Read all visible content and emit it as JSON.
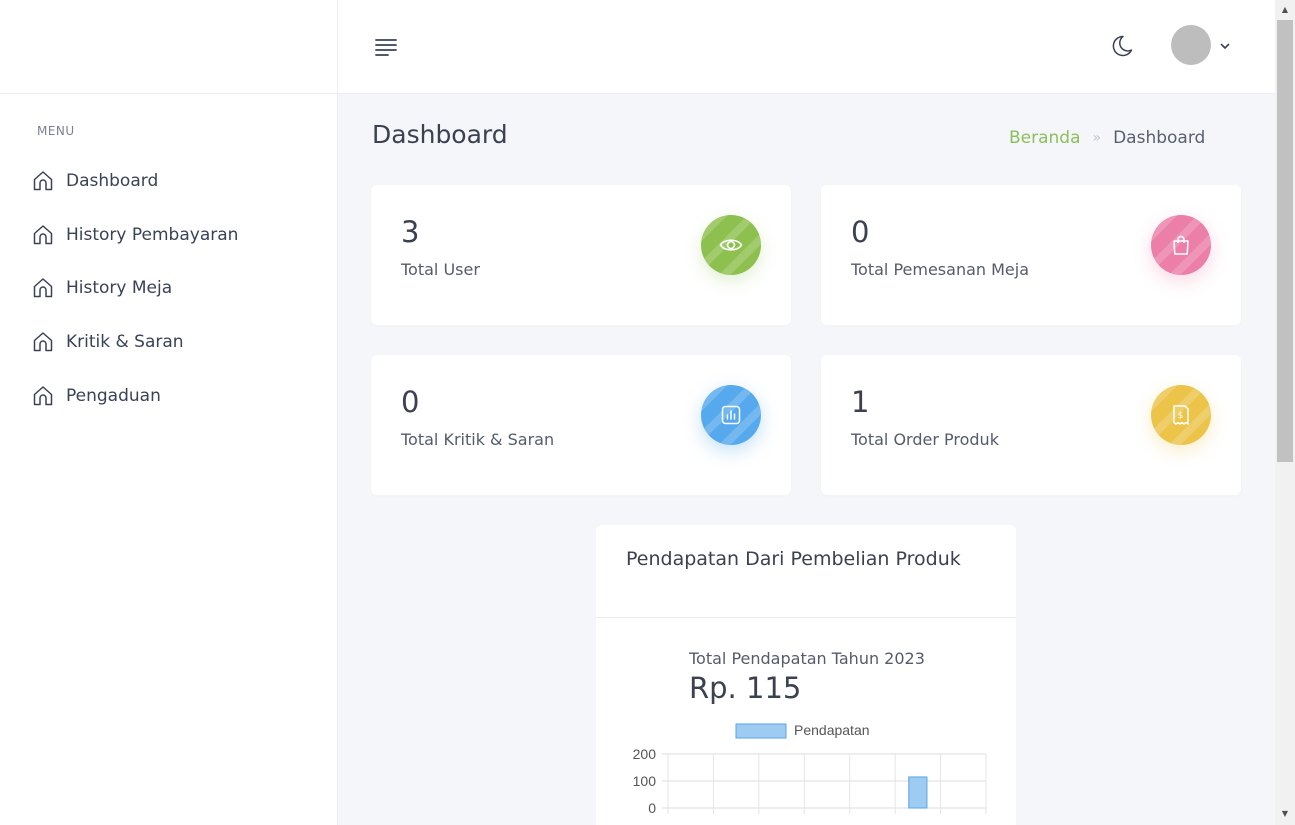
{
  "sidebar": {
    "menu_heading": "MENU",
    "items": [
      {
        "label": "Dashboard",
        "icon": "home-icon"
      },
      {
        "label": "History Pembayaran",
        "icon": "home-icon"
      },
      {
        "label": "History Meja",
        "icon": "home-icon"
      },
      {
        "label": "Kritik & Saran",
        "icon": "home-icon"
      },
      {
        "label": "Pengaduan",
        "icon": "home-icon"
      }
    ]
  },
  "topbar": {
    "menu_icon": "hamburger-menu-icon",
    "theme_icon": "moon-icon",
    "avatar_icon": "avatar",
    "dropdown_icon": "chevron-down-icon"
  },
  "page": {
    "title": "Dashboard",
    "breadcrumb": {
      "home": "Beranda",
      "separator": "»",
      "current": "Dashboard"
    }
  },
  "stats": [
    {
      "value": "3",
      "label": "Total User",
      "icon": "eye-icon",
      "color": "#8dc04e"
    },
    {
      "value": "0",
      "label": "Total Pemesanan Meja",
      "icon": "shopping-bag-icon",
      "color": "#ec7fa8"
    },
    {
      "value": "0",
      "label": "Total Kritik & Saran",
      "icon": "bar-chart-icon",
      "color": "#55a9ec"
    },
    {
      "value": "1",
      "label": "Total Order Produk",
      "icon": "receipt-dollar-icon",
      "color": "#ecc44a"
    }
  ],
  "revenue": {
    "card_title": "Pendapatan Dari Pembelian Produk",
    "subtitle": "Total Pendapatan Tahun 2023",
    "total": "Rp. 115"
  },
  "chart_data": {
    "type": "bar",
    "series": [
      {
        "name": "Pendapatan",
        "values": [
          0,
          0,
          0,
          0,
          0,
          115,
          0
        ],
        "color": "#9ecbf1",
        "border": "#5aa5e3"
      }
    ],
    "yticks": [
      "200",
      "100",
      "0"
    ],
    "ylim": [
      0,
      200
    ],
    "grid": true,
    "legend": "top"
  },
  "colors": {
    "accent_green": "#8cbf59",
    "text_dark": "#3c4150"
  }
}
